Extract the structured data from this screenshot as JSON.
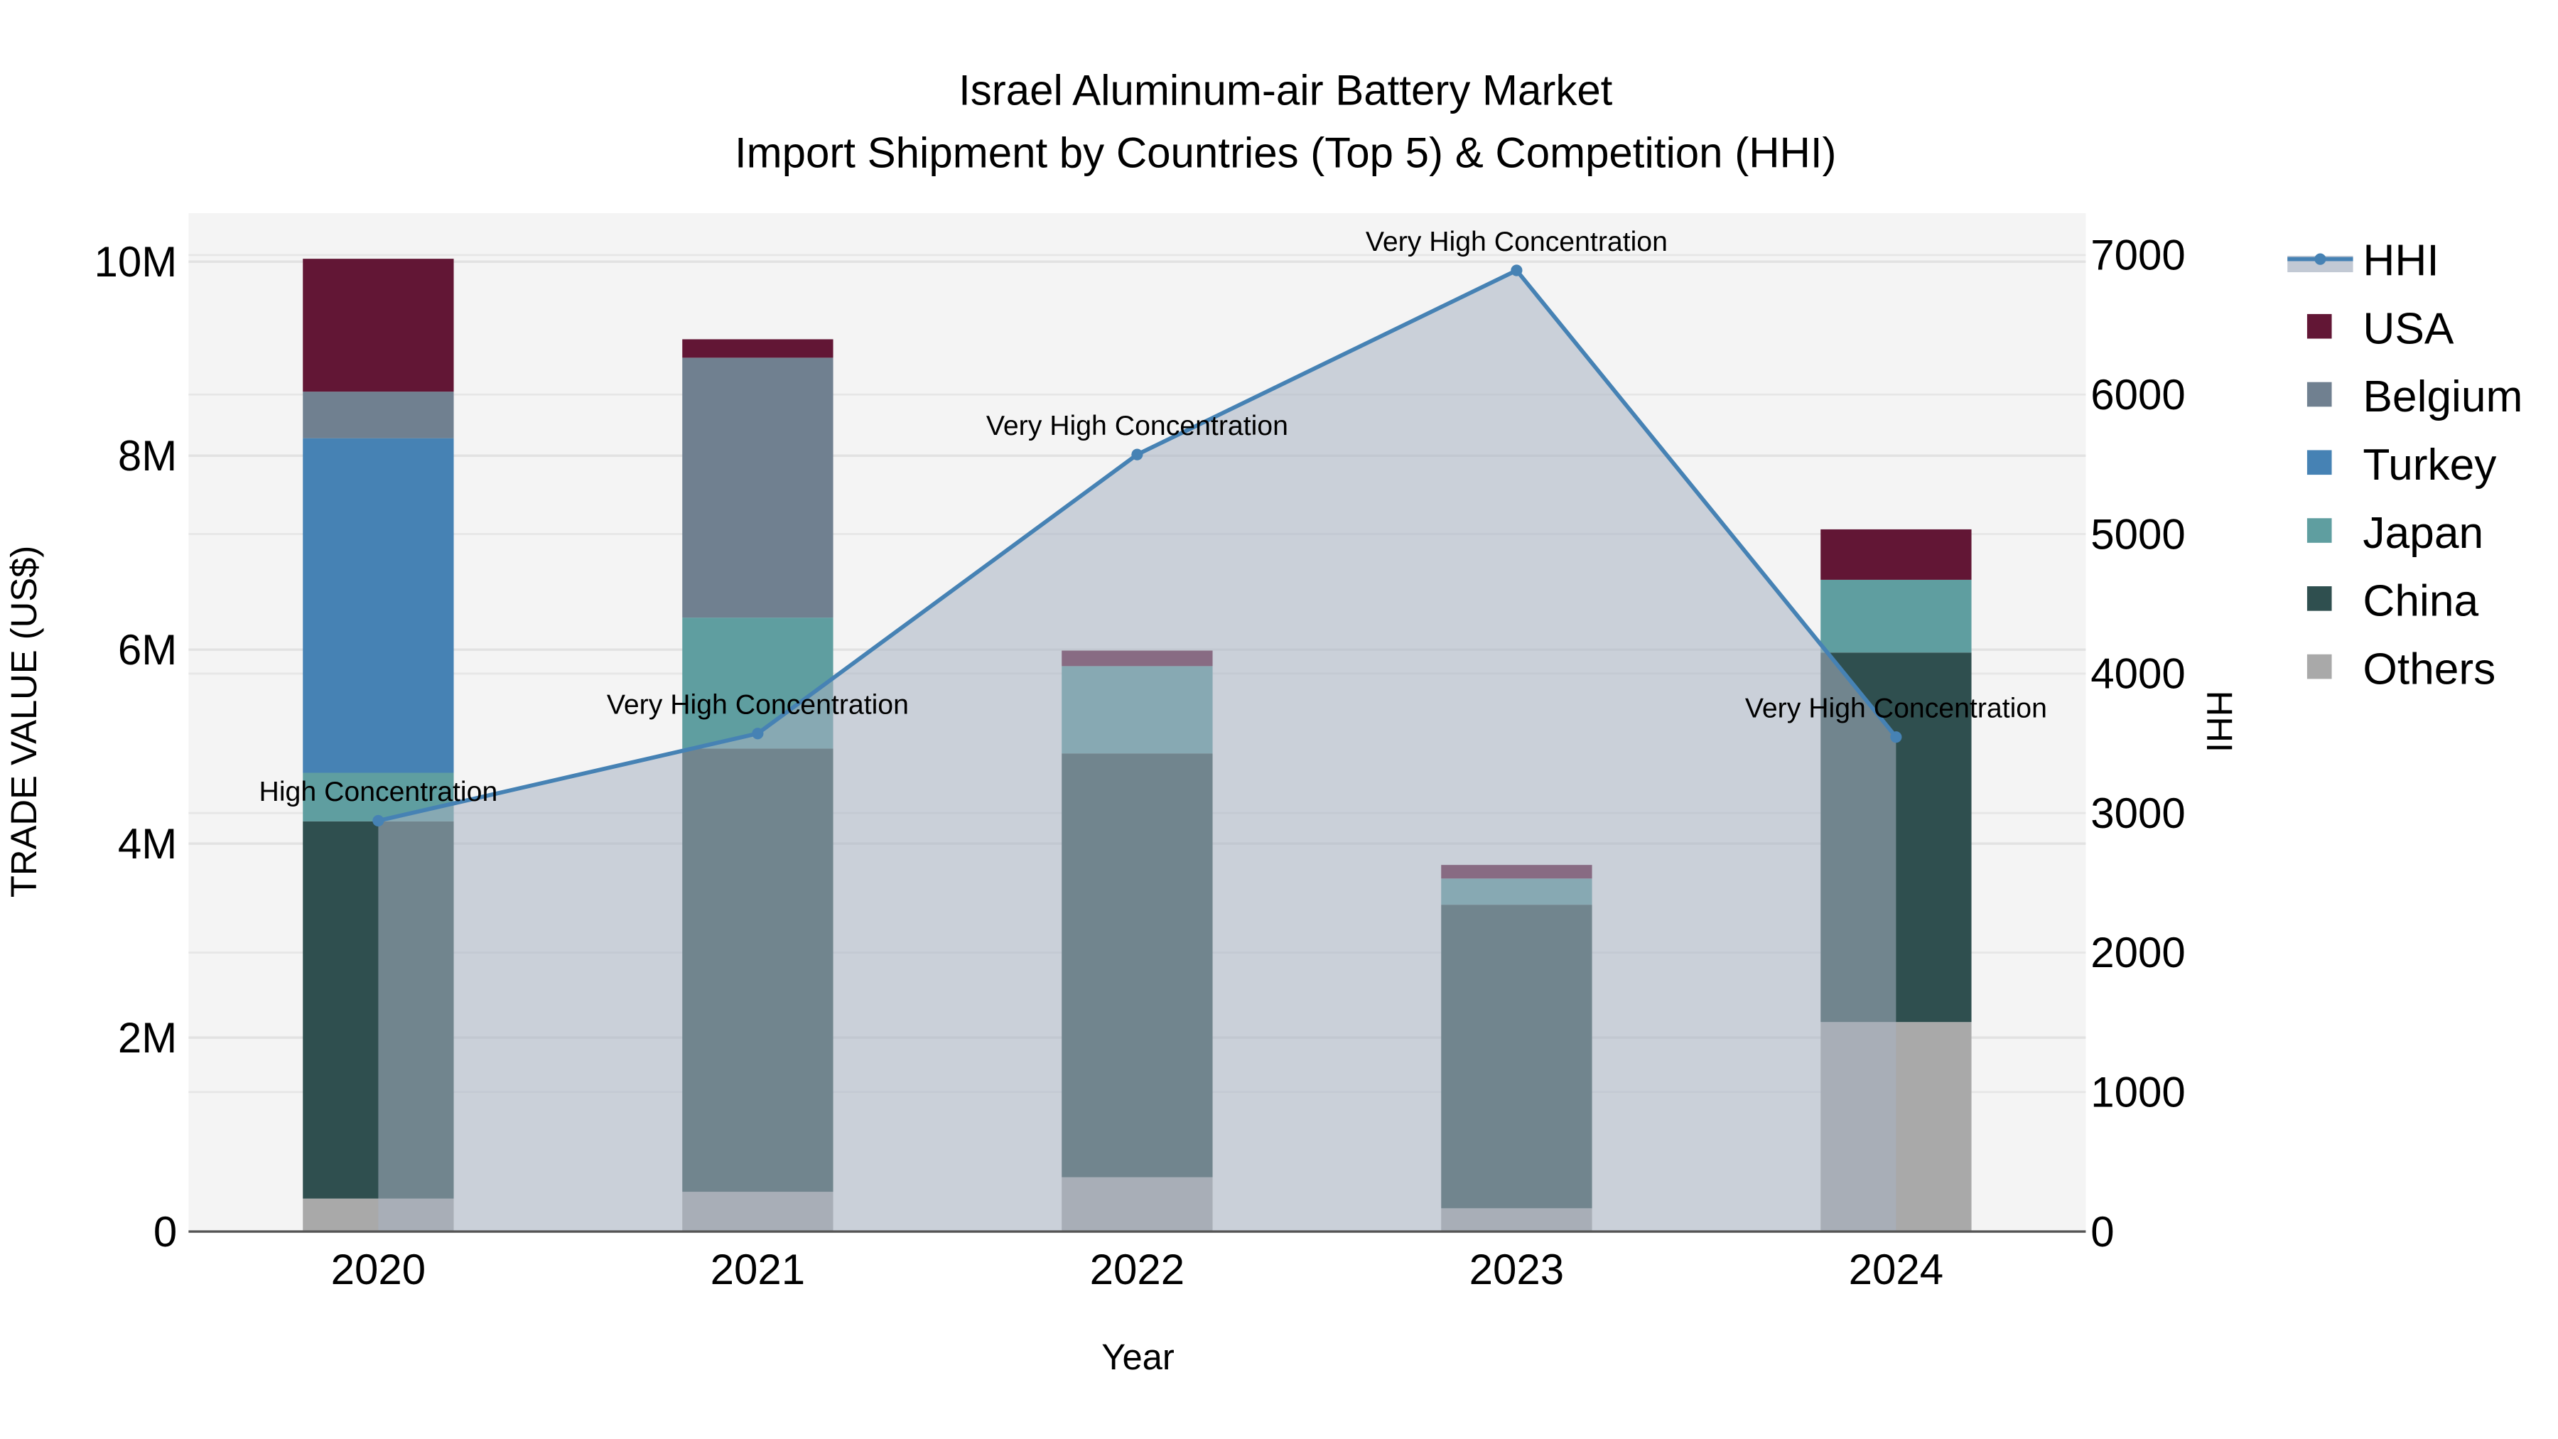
{
  "chart_data": {
    "type": "bar",
    "title": "Israel Aluminum-air Battery Market",
    "subtitle": "Import Shipment by Countries (Top 5) & Competition (HHI)",
    "xlabel": "Year",
    "ylabel": "TRADE VALUE (US$)",
    "y2label": "HHI",
    "categories": [
      "2020",
      "2021",
      "2022",
      "2023",
      "2024"
    ],
    "ylim": [
      0,
      10500000
    ],
    "y2lim": [
      0,
      7300
    ],
    "yticks": [
      0,
      2000000,
      4000000,
      6000000,
      8000000,
      10000000
    ],
    "ytick_labels": [
      "0",
      "2M",
      "4M",
      "6M",
      "8M",
      "10M"
    ],
    "y2ticks": [
      0,
      1000,
      2000,
      3000,
      4000,
      5000,
      6000,
      7000
    ],
    "y2tick_labels": [
      "0",
      "1000",
      "2000",
      "3000",
      "4000",
      "5000",
      "6000",
      "7000"
    ],
    "barmode": "stack",
    "legend_position": "right",
    "series": [
      {
        "name": "Others",
        "color": "#A9A9A9",
        "values": [
          340000,
          410000,
          560000,
          240000,
          2160000
        ]
      },
      {
        "name": "China",
        "color": "#2F4F4F",
        "values": [
          3890000,
          4570000,
          4370000,
          3130000,
          3810000
        ]
      },
      {
        "name": "Japan",
        "color": "#5F9EA0",
        "values": [
          500000,
          1350000,
          900000,
          270000,
          750000
        ]
      },
      {
        "name": "Turkey",
        "color": "#4682B4",
        "values": [
          3450000,
          0,
          0,
          0,
          0
        ]
      },
      {
        "name": "Belgium",
        "color": "#708090",
        "values": [
          480000,
          2680000,
          0,
          0,
          0
        ]
      },
      {
        "name": "USA",
        "color": "#621635",
        "values": [
          1370000,
          190000,
          160000,
          140000,
          520000
        ]
      }
    ],
    "hhi": {
      "name": "HHI",
      "color": "#4682B4",
      "values": [
        2945,
        3570,
        5570,
        6890,
        3545
      ],
      "annotations": [
        "High Concentration",
        "Very High Concentration",
        "Very High Concentration",
        "Very High Concentration",
        "Very High Concentration"
      ]
    },
    "legend": [
      "HHI",
      "USA",
      "Belgium",
      "Turkey",
      "Japan",
      "China",
      "Others"
    ]
  }
}
